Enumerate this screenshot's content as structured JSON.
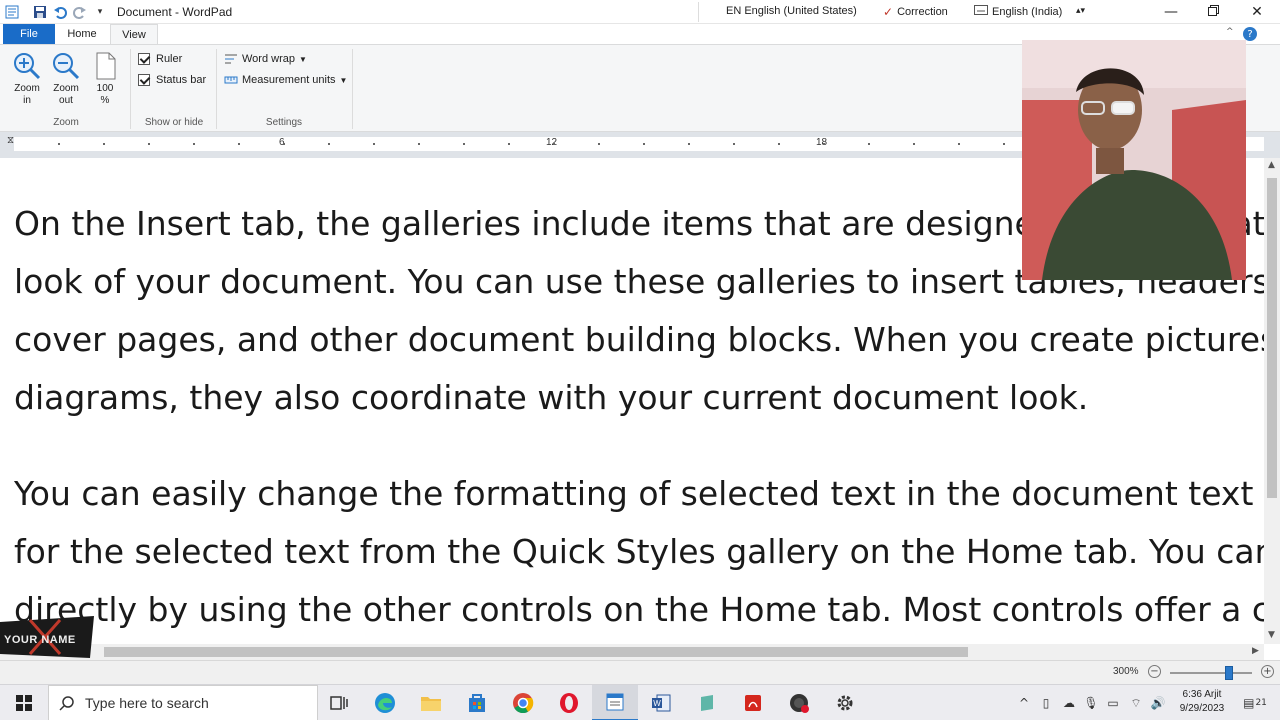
{
  "titlebar": {
    "title": "Document - WordPad",
    "input_language": "EN English (United States)",
    "correction": "Correction",
    "keyboard": "English (India)"
  },
  "ribbon": {
    "tabs": [
      {
        "label": "File"
      },
      {
        "label": "Home"
      },
      {
        "label": "View"
      }
    ],
    "zoom_group": {
      "label": "Zoom",
      "zoom_in_line1": "Zoom",
      "zoom_in_line2": "in",
      "zoom_out_line1": "Zoom",
      "zoom_out_line2": "out",
      "hundred_line1": "100",
      "hundred_line2": "%"
    },
    "show_hide_group": {
      "label": "Show or hide",
      "ruler": "Ruler",
      "status_bar": "Status bar"
    },
    "settings_group": {
      "label": "Settings",
      "word_wrap": "Word wrap",
      "measurement_units": "Measurement units"
    }
  },
  "ruler": {
    "marks": [
      "6",
      "12",
      "18"
    ]
  },
  "document": {
    "paragraph1": [
      "On the Insert tab, the galleries include items that are designed to coordinate with the overall",
      "look of your document. You can use these galleries to insert tables, headers, footers, lists,",
      "cover pages, and other document building blocks. When you create pictures, charts, or",
      "diagrams, they also coordinate with your current document look."
    ],
    "paragraph2": [
      "You can easily change the formatting of selected text in the document text by choosing a look",
      "for the selected text from the Quick Styles gallery on the Home tab. You can also format text",
      "directly by using the other controls on the Home tab. Most controls offer a choice"
    ]
  },
  "statusbar": {
    "zoom_level": "300%",
    "zoom_fraction": 0.72
  },
  "taskbar": {
    "search_placeholder": "Type here to search",
    "clock_time": "6:36 Arjit",
    "clock_date": "9/29/2023",
    "notification_count": "21"
  },
  "watermark": {
    "text": "YOUR NAME"
  },
  "colors": {
    "file_tab": "#1a6cc8",
    "accent": "#2b79c9",
    "ribbon_bg": "#f5f6f7",
    "ruler_bg": "#dfe3e8"
  }
}
